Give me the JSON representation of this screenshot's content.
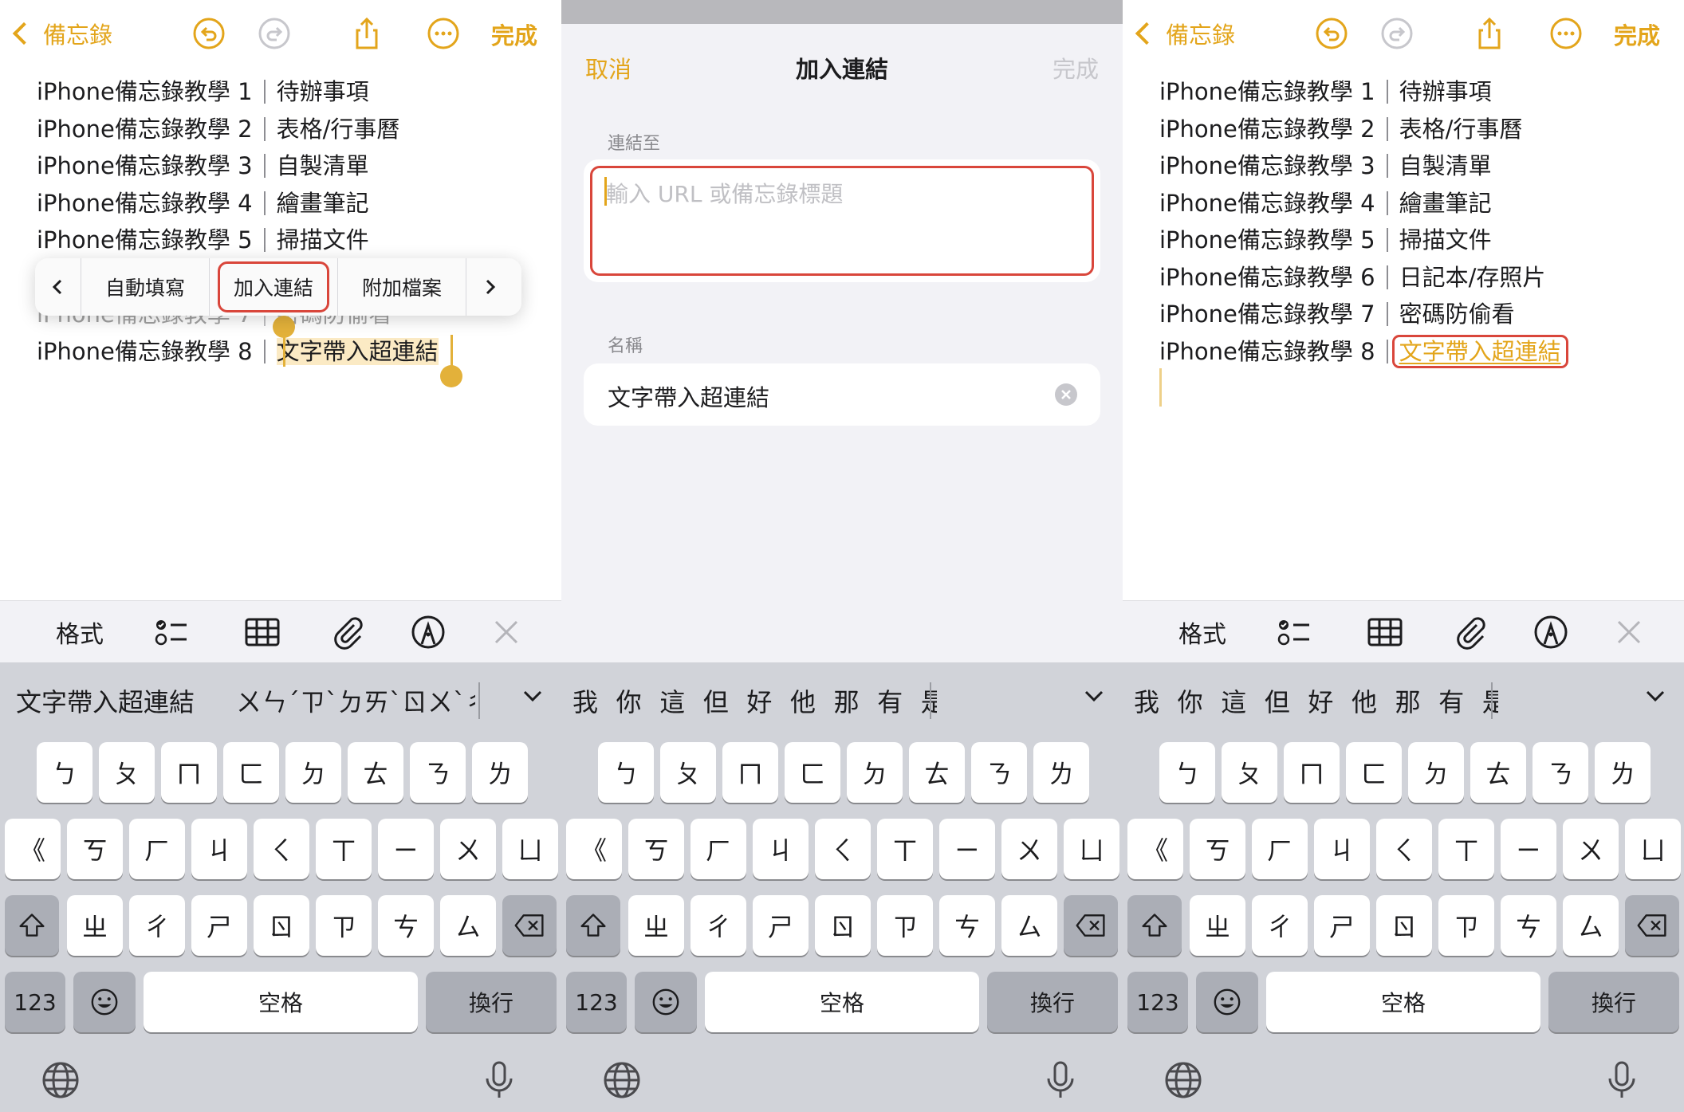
{
  "nav": {
    "back_label": "備忘錄",
    "done_label": "完成"
  },
  "notes": {
    "prefix": "iPhone備忘錄教學",
    "lines": [
      {
        "num": "1",
        "topic": "待辦事項"
      },
      {
        "num": "2",
        "topic": "表格/行事曆"
      },
      {
        "num": "3",
        "topic": "自製清單"
      },
      {
        "num": "4",
        "topic": "繪畫筆記"
      },
      {
        "num": "5",
        "topic": "掃描文件"
      },
      {
        "num": "6",
        "topic": "日記本/存照片"
      },
      {
        "num": "7",
        "topic": "密碼防偷看"
      },
      {
        "num": "8",
        "topic": "文字帶入超連結"
      }
    ]
  },
  "context_menu": {
    "items": [
      "自動填寫",
      "加入連結",
      "附加檔案"
    ],
    "highlighted_index": 1
  },
  "toolbar": {
    "format_label": "格式"
  },
  "keyboard": {
    "candidates_screen1": [
      "文字帶入超連結",
      "ㄨㄣˊㄗˋㄉㄞˋㄖㄨˋㄔ"
    ],
    "candidates_common": [
      "我",
      "你",
      "這",
      "但",
      "好",
      "他",
      "那",
      "有",
      "是"
    ],
    "row1": [
      "ㄅ",
      "ㄆ",
      "ㄇ",
      "ㄈ",
      "ㄉ",
      "ㄊ",
      "ㄋ",
      "ㄌ"
    ],
    "row2": [
      "《",
      "ㄎ",
      "ㄏ",
      "ㄐ",
      "ㄑ",
      "ㄒ",
      "ㄧ",
      "ㄨ",
      "ㄩ"
    ],
    "row3": [
      "ㄓ",
      "ㄔ",
      "ㄕ",
      "ㄖ",
      "ㄗ",
      "ㄘ",
      "ㄙ"
    ],
    "numbers_label": "123",
    "space_label": "空格",
    "return_label": "換行"
  },
  "link_dialog": {
    "cancel_label": "取消",
    "title": "加入連結",
    "done_label": "完成",
    "link_to_label": "連結至",
    "url_placeholder": "輸入 URL 或備忘錄標題",
    "name_label": "名稱",
    "name_value": "文字帶入超連結"
  },
  "colors": {
    "accent": "#e3a51b",
    "highlight_box": "#d9463b",
    "selection": "#fbeac4",
    "keyboard_bg": "#d1d3d9",
    "special_key": "#abaeb6"
  }
}
